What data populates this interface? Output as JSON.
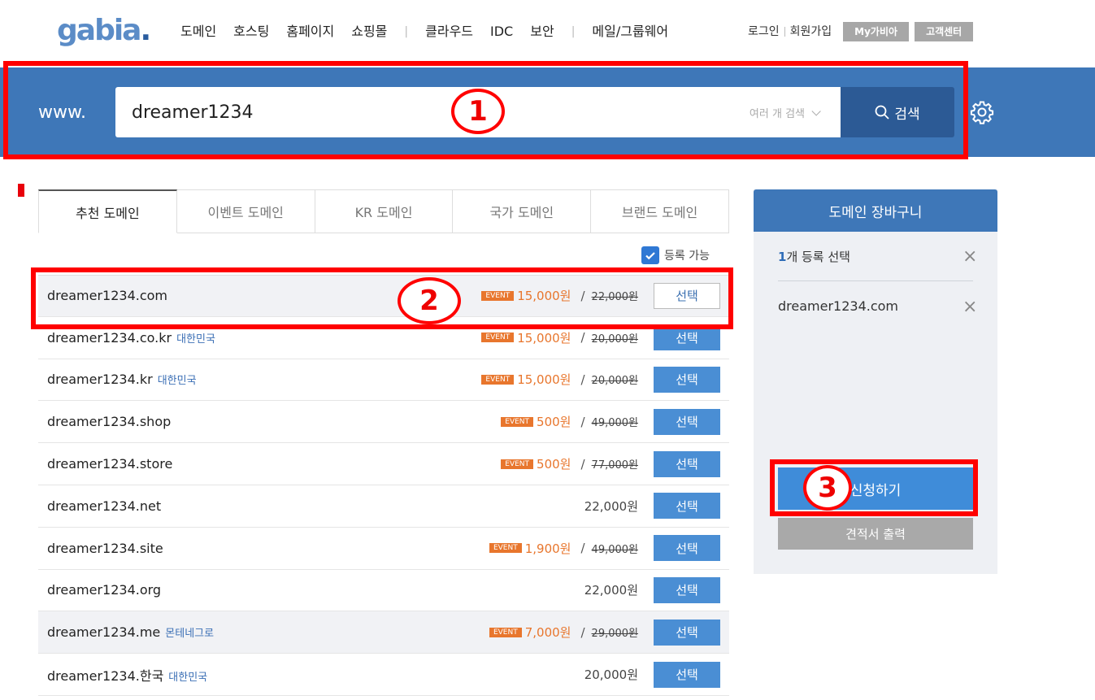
{
  "nav": {
    "logo": "gabia",
    "logo_dot": ".",
    "menu": [
      "도메인",
      "호스팅",
      "홈페이지",
      "쇼핑몰",
      "클라우드",
      "IDC",
      "보안",
      "메일/그룹웨어"
    ],
    "login": "로그인",
    "signup": "회원가입",
    "mygabia": "My가비아",
    "support": "고객센터"
  },
  "search": {
    "prefix": "www.",
    "value": "dreamer1234",
    "multi_label": "여러 개 검색",
    "button": "검색"
  },
  "tabs": [
    "추천 도메인",
    "이벤트 도메인",
    "KR 도메인",
    "국가 도메인",
    "브랜드 도메인"
  ],
  "filter": {
    "available_label": "등록 가능",
    "checked": true
  },
  "event_label": "EVENT",
  "domains": [
    {
      "name": "dreamer1234.com",
      "country": "",
      "event": true,
      "price": "15,000원",
      "original": "22,000원",
      "select": "선택"
    },
    {
      "name": "dreamer1234.co.kr",
      "country": "대한민국",
      "event": true,
      "price": "15,000원",
      "original": "20,000원",
      "select": "선택"
    },
    {
      "name": "dreamer1234.kr",
      "country": "대한민국",
      "event": true,
      "price": "15,000원",
      "original": "20,000원",
      "select": "선택"
    },
    {
      "name": "dreamer1234.shop",
      "country": "",
      "event": true,
      "price": "500원",
      "original": "49,000원",
      "select": "선택"
    },
    {
      "name": "dreamer1234.store",
      "country": "",
      "event": true,
      "price": "500원",
      "original": "77,000원",
      "select": "선택"
    },
    {
      "name": "dreamer1234.net",
      "country": "",
      "event": false,
      "price": "22,000원",
      "original": "",
      "select": "선택"
    },
    {
      "name": "dreamer1234.site",
      "country": "",
      "event": true,
      "price": "1,900원",
      "original": "49,000원",
      "select": "선택"
    },
    {
      "name": "dreamer1234.org",
      "country": "",
      "event": false,
      "price": "22,000원",
      "original": "",
      "select": "선택"
    },
    {
      "name": "dreamer1234.me",
      "country": "몬테네그로",
      "event": true,
      "price": "7,000원",
      "original": "29,000원",
      "select": "선택"
    },
    {
      "name": "dreamer1234.한국",
      "country": "대한민국",
      "event": false,
      "price": "20,000원",
      "original": "",
      "select": "선택"
    }
  ],
  "cart": {
    "title": "도메인 장바구니",
    "count": "1",
    "count_suffix": "개 등록 선택",
    "items": [
      "dreamer1234.com"
    ],
    "apply": "신청하기",
    "estimate": "견적서 출력"
  },
  "annotations": [
    "1",
    "2",
    "3"
  ],
  "colors": {
    "brand_blue": "#3e77b8",
    "event_orange": "#e8762d",
    "annotation_red": "#ff0000"
  }
}
